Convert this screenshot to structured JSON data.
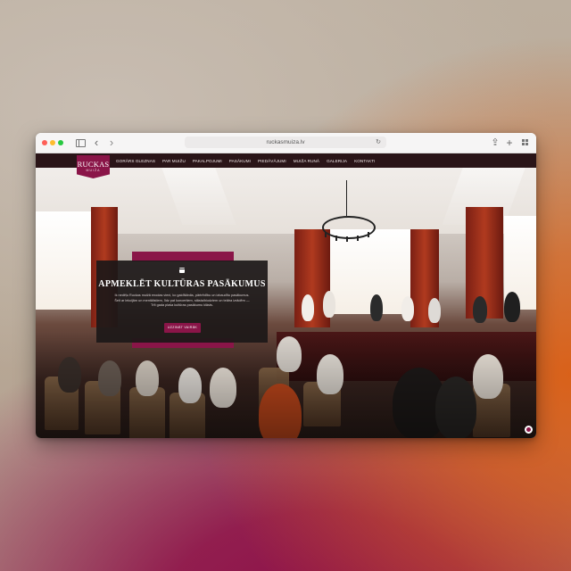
{
  "browser": {
    "url": "ruckasmuiza.lv"
  },
  "site": {
    "logo": {
      "main": "RUCKAS",
      "sub": "MUIŽA"
    },
    "nav": [
      "GORĀRS GLEZNAS",
      "PAR MUIŽU",
      "PAKALPOJUMI",
      "PASĀKUMI",
      "PIEDĀVĀJUMI",
      "MUIŽA RUNĀ",
      "GALERIJA",
      "KONTAKTI"
    ],
    "hero": {
      "title": "APMEKLĒT KULTŪRAS PASĀKUMUS",
      "text": "Ik nedēļu Ruckas muižā enodas vieni, ko gaidīšānās, pārtrēdību un izbaudītu pasākumus. Šeit ar lekcijām un mentālistiem, līdz pat koncertiem, stāsta/biodziem un teātra izrādēm — Trīt gada plaša kultūras pasākumu klāsts.",
      "button": "UZZINĀT VAIRĀK"
    },
    "colors": {
      "accent": "#8a1548",
      "nav_bg": "#2a1518",
      "card_bg": "#1c1818"
    }
  },
  "icons": {
    "sidebar": "sidebar-icon",
    "back": "chevron-left-icon",
    "forward": "chevron-right-icon",
    "reload": "reload-icon",
    "share": "share-icon",
    "new_tab": "plus-icon",
    "tabs": "tab-overview-icon",
    "calendar": "calendar-icon",
    "chat": "chat-icon"
  }
}
